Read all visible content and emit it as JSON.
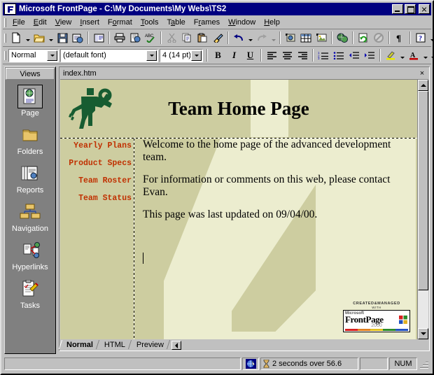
{
  "window": {
    "title": "Microsoft FrontPage - C:\\My Documents\\My Webs\\TS2",
    "app_icon": "frontpage-icon",
    "minimize_label": "Minimize",
    "maximize_label": "Maximize",
    "close_label": "Close"
  },
  "menu": {
    "items": [
      {
        "label": "File",
        "accel": "F"
      },
      {
        "label": "Edit",
        "accel": "E"
      },
      {
        "label": "View",
        "accel": "V"
      },
      {
        "label": "Insert",
        "accel": "I"
      },
      {
        "label": "Format",
        "accel": "o"
      },
      {
        "label": "Tools",
        "accel": "T"
      },
      {
        "label": "Table",
        "accel": "a"
      },
      {
        "label": "Frames",
        "accel": "a"
      },
      {
        "label": "Window",
        "accel": "W"
      },
      {
        "label": "Help",
        "accel": "H"
      }
    ]
  },
  "standard_toolbar": {
    "buttons": [
      {
        "name": "new-page-button",
        "icon": "new-page-icon",
        "tooltip": "New Page"
      },
      {
        "name": "new-page-dropdown",
        "icon": "chevron-down-icon"
      },
      {
        "name": "open-button",
        "icon": "open-folder-icon",
        "tooltip": "Open"
      },
      {
        "name": "open-dropdown",
        "icon": "chevron-down-icon"
      },
      {
        "name": "save-button",
        "icon": "floppy-disk-icon",
        "tooltip": "Save"
      },
      {
        "name": "publish-web-button",
        "icon": "publish-web-icon",
        "tooltip": "Publish Web"
      },
      {
        "name": "folder-list-button",
        "icon": "folder-list-icon",
        "tooltip": "Folder List"
      },
      {
        "name": "print-button",
        "icon": "printer-icon",
        "tooltip": "Print"
      },
      {
        "name": "print-preview-button",
        "icon": "print-preview-icon",
        "tooltip": "Print Preview"
      },
      {
        "name": "spelling-button",
        "icon": "spell-check-icon",
        "tooltip": "Spelling"
      },
      {
        "name": "cut-button",
        "icon": "scissors-icon",
        "tooltip": "Cut"
      },
      {
        "name": "copy-button",
        "icon": "copy-icon",
        "tooltip": "Copy"
      },
      {
        "name": "paste-button",
        "icon": "paste-icon",
        "tooltip": "Paste"
      },
      {
        "name": "format-painter-button",
        "icon": "format-painter-icon",
        "tooltip": "Format Painter"
      },
      {
        "name": "undo-button",
        "icon": "undo-arrow-icon",
        "tooltip": "Undo"
      },
      {
        "name": "undo-dropdown",
        "icon": "chevron-down-icon"
      },
      {
        "name": "redo-button",
        "icon": "redo-arrow-icon",
        "tooltip": "Redo"
      },
      {
        "name": "redo-dropdown",
        "icon": "chevron-down-icon"
      },
      {
        "name": "insert-component-button",
        "icon": "component-icon",
        "tooltip": "Insert Component"
      },
      {
        "name": "insert-table-button",
        "icon": "table-grid-icon",
        "tooltip": "Insert Table"
      },
      {
        "name": "insert-picture-button",
        "icon": "picture-icon",
        "tooltip": "Insert Picture From File"
      },
      {
        "name": "hyperlink-button",
        "icon": "globe-link-icon",
        "tooltip": "Hyperlink"
      },
      {
        "name": "refresh-button",
        "icon": "refresh-page-icon",
        "tooltip": "Refresh"
      },
      {
        "name": "stop-button",
        "icon": "stop-icon",
        "tooltip": "Stop"
      },
      {
        "name": "show-all-button",
        "icon": "pilcrow-icon",
        "tooltip": "Show All"
      },
      {
        "name": "help-button",
        "icon": "question-help-icon",
        "tooltip": "Microsoft FrontPage Help"
      },
      {
        "name": "toolbar-options",
        "icon": "chevron-down-icon"
      }
    ]
  },
  "formatting_toolbar": {
    "style_value": "Normal",
    "font_value": "(default font)",
    "size_value": "4  (14 pt)",
    "bold_label": "B",
    "italic_label": "I",
    "underline_label": "U",
    "buttons": [
      {
        "name": "align-left-button",
        "icon": "align-left-icon"
      },
      {
        "name": "align-center-button",
        "icon": "align-center-icon"
      },
      {
        "name": "align-right-button",
        "icon": "align-right-icon"
      },
      {
        "name": "numbered-list-button",
        "icon": "numbered-list-icon"
      },
      {
        "name": "bulleted-list-button",
        "icon": "bulleted-list-icon"
      },
      {
        "name": "decrease-indent-button",
        "icon": "decrease-indent-icon"
      },
      {
        "name": "increase-indent-button",
        "icon": "increase-indent-icon"
      },
      {
        "name": "highlight-button",
        "icon": "highlight-pen-icon"
      },
      {
        "name": "font-color-button",
        "icon": "font-color-icon"
      }
    ]
  },
  "views_bar": {
    "caption": "Views",
    "items": [
      {
        "label": "Page",
        "icon": "page-view-icon",
        "selected": true
      },
      {
        "label": "Folders",
        "icon": "folders-view-icon",
        "selected": false
      },
      {
        "label": "Reports",
        "icon": "reports-view-icon",
        "selected": false
      },
      {
        "label": "Navigation",
        "icon": "navigation-view-icon",
        "selected": false
      },
      {
        "label": "Hyperlinks",
        "icon": "hyperlinks-view-icon",
        "selected": false
      },
      {
        "label": "Tasks",
        "icon": "tasks-view-icon",
        "selected": false
      }
    ]
  },
  "document": {
    "tab_name": "index.htm",
    "close_label": "×",
    "page": {
      "logo_alt": "team-logo-wrench-figure",
      "title": "Team Home Page",
      "nav_links": [
        "Yearly Plans",
        "Product Specs",
        "Team Roster",
        "Team Status"
      ],
      "paragraphs": [
        "Welcome to the home page of the advanced development team.",
        "For information or comments on this web, please contact Evan.",
        "This page was last updated on 09/04/00."
      ],
      "badge": {
        "line1": "CREATED&MANAGED",
        "line2": "WITH",
        "brand_small": "Microsoft",
        "brand_main": "FrontPage",
        "brand_year": "2000"
      },
      "bg_color": "#cdcda0",
      "band_color": "#ecedcf",
      "nav_link_color": "#c03000"
    }
  },
  "view_tabs": [
    {
      "label": "Normal",
      "active": true
    },
    {
      "label": "HTML",
      "active": false
    },
    {
      "label": "Preview",
      "active": false
    }
  ],
  "status_bar": {
    "globe_icon": "globe-cursor-icon",
    "timer_icon": "hourglass-icon",
    "download_time": "2 seconds over 56.6",
    "num_lock": "NUM"
  }
}
